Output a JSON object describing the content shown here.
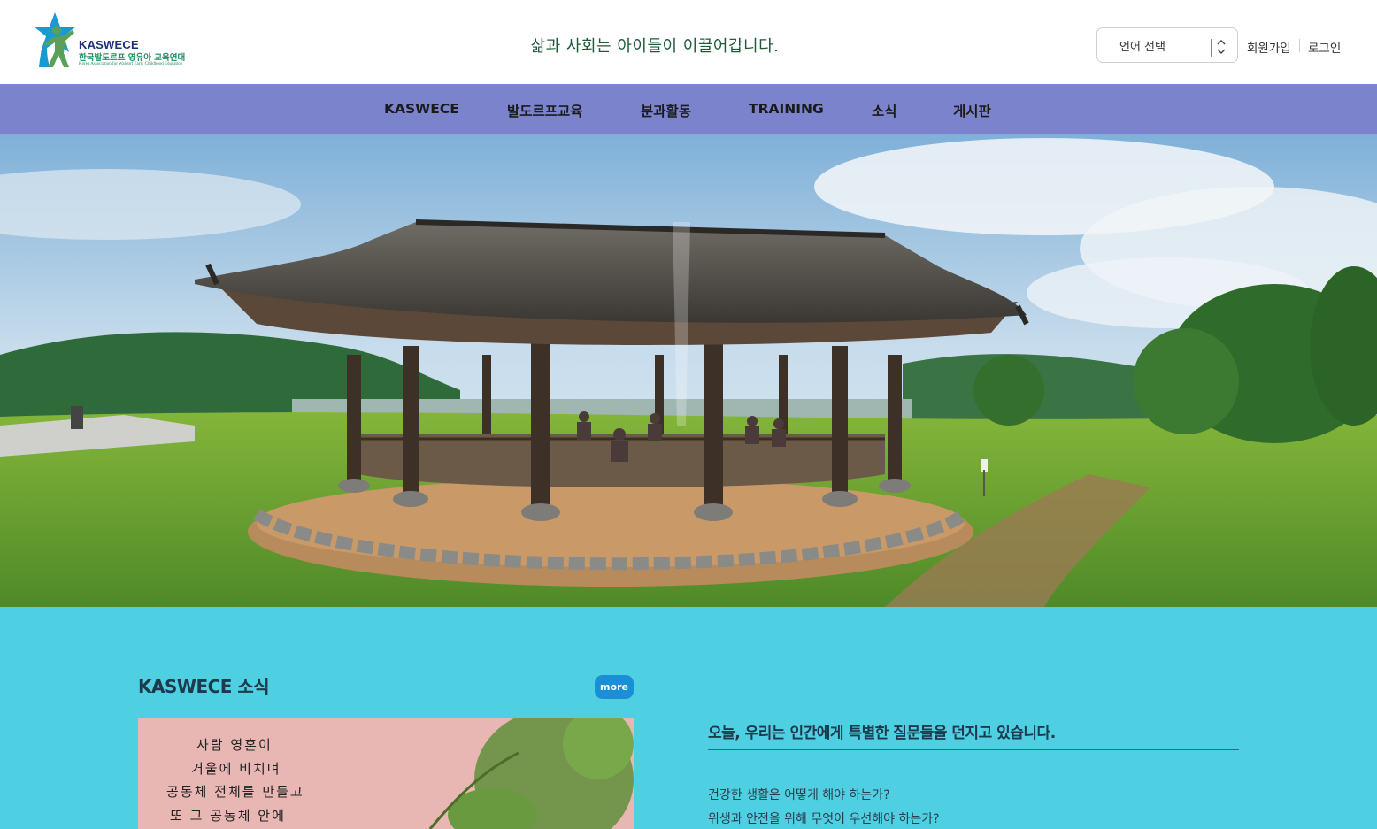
{
  "header": {
    "logo": {
      "name": "KASWECE",
      "korean_name": "한국발도르프 영유아 교육연대",
      "english_name": "Korea Association for Waldorf Early Childhood Education"
    },
    "tagline": "삶과 사회는 아이들이 이끌어갑니다.",
    "language_select": {
      "label": "언어 선택"
    },
    "signup_label": "회원가입",
    "login_label": "로그인"
  },
  "nav": {
    "items": [
      {
        "label": "KASWECE"
      },
      {
        "label": "발도르프교육"
      },
      {
        "label": "분과활동"
      },
      {
        "label": "TRAINING"
      },
      {
        "label": "소식"
      },
      {
        "label": "게시판"
      }
    ]
  },
  "news": {
    "title": "KASWECE 소식",
    "more_label": "more",
    "image_poem": [
      "사람 영혼이",
      "거울에 비치며",
      "공동체 전체를 만들고",
      "또 그 공동체 안에"
    ]
  },
  "intro": {
    "heading": "오늘, 우리는 인간에게 특별한 질문들을 던지고 있습니다.",
    "questions": [
      "건강한 생활은 어떻게 해야 하는가?",
      "위생과 안전을 위해 무엇이 우선해야 하는가?"
    ]
  },
  "colors": {
    "nav_background": "#7b83cc",
    "content_background": "#4ecfe2",
    "more_button": "#1a8fd6",
    "tagline_text": "#1f5a3a"
  }
}
